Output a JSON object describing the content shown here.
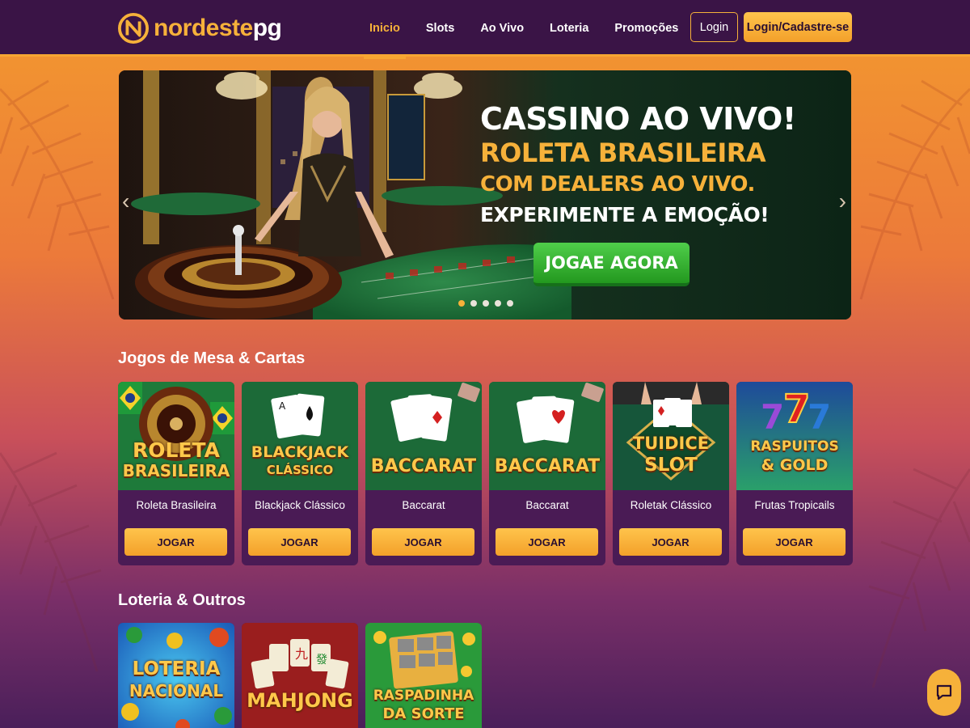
{
  "brand": {
    "name_part1": "nordeste",
    "name_part2": "pg"
  },
  "nav": {
    "items": [
      {
        "label": "Inicio",
        "active": true
      },
      {
        "label": "Slots",
        "active": false
      },
      {
        "label": "Ao Vivo",
        "active": false
      },
      {
        "label": "Loteria",
        "active": false
      },
      {
        "label": "Promoções",
        "active": false
      }
    ],
    "login_label": "Login",
    "signup_label": "Login/Cadastre-se"
  },
  "banner": {
    "line1": "CASSINO AO VIVO!",
    "line2": "ROLETA BRASILEIRA",
    "line3": "COM DEALERS AO VIVO.",
    "line4": "EXPERIMENTE A EMOÇÃO!",
    "cta": "JOGAE AGORA",
    "slides": 5,
    "active_slide": 1
  },
  "section_table": {
    "title": "Jogos de Mesa & Cartas",
    "games": [
      {
        "thumb_text": [
          "ROLETA",
          "BRASILEIRA"
        ],
        "name": "Roleta Brasileira",
        "button": "JOGAR"
      },
      {
        "thumb_text": [
          "BLACKJACK",
          "CLÁSSICO"
        ],
        "name": "Blackjack Clássico",
        "button": "JOGAR"
      },
      {
        "thumb_text": [
          "BACCARAT"
        ],
        "name": "Baccarat",
        "button": "JOGAR"
      },
      {
        "thumb_text": [
          "BACCARAT"
        ],
        "name": "Baccarat",
        "button": "JOGAR"
      },
      {
        "thumb_text": [
          "TUIDICE",
          "SLOT"
        ],
        "name": "Roletak Clássico",
        "button": "JOGAR"
      },
      {
        "thumb_text": [
          "RASPUITOS",
          "& GOLD"
        ],
        "name": "Frutas Tropicails",
        "button": "JOGAR"
      }
    ]
  },
  "section_lottery": {
    "title": "Loteria & Outros",
    "games": [
      {
        "thumb_text": [
          "LOTERIA",
          "NACIONAL"
        ]
      },
      {
        "thumb_text": [
          "MAHJONG"
        ]
      },
      {
        "thumb_text": [
          "RASPADINHA",
          "DA SORTE"
        ]
      }
    ]
  },
  "colors": {
    "accent": "#f6b13a",
    "header_bg": "#3a1446",
    "card_bg": "#4a1b55",
    "cta_green": "#23981f"
  },
  "icons": {
    "chat": "chat-icon",
    "prev": "chevron-left-icon",
    "next": "chevron-right-icon"
  }
}
